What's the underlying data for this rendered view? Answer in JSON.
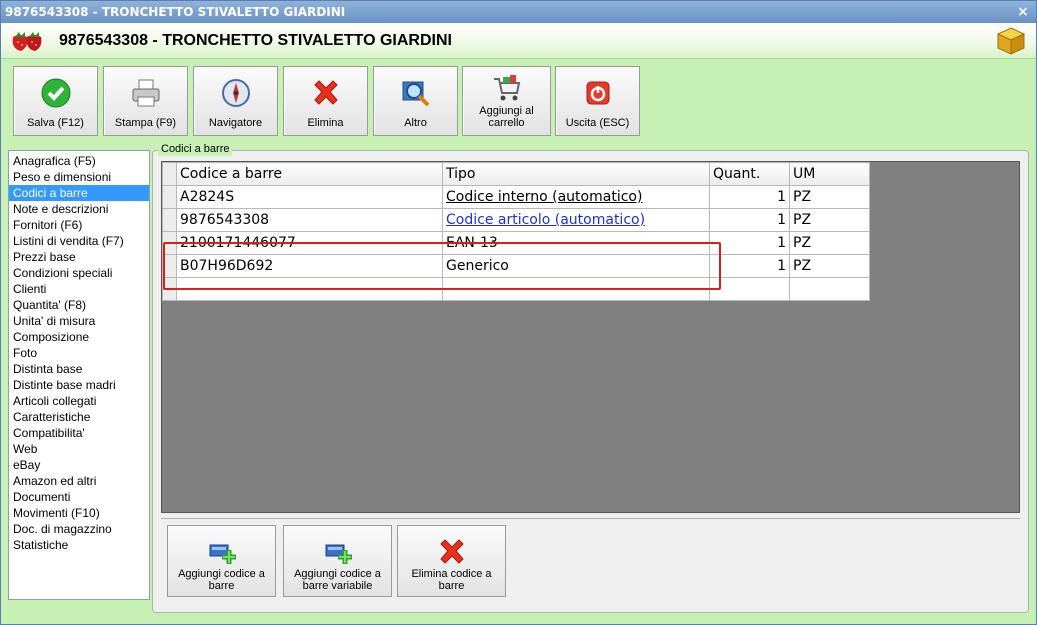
{
  "window": {
    "title": "9876543308 - TRONCHETTO STIVALETTO GIARDINI",
    "close": "×"
  },
  "header": {
    "title": "9876543308 - TRONCHETTO STIVALETTO GIARDINI",
    "logo_icon": "strawberry-icon",
    "corner_icon": "cube-icon"
  },
  "toolbar": [
    {
      "label": "Salva (F12)",
      "icon": "check-icon"
    },
    {
      "label": "Stampa (F9)",
      "icon": "printer-icon"
    },
    {
      "label": "Navigatore",
      "icon": "compass-icon"
    },
    {
      "label": "Elimina",
      "icon": "delete-x-icon"
    },
    {
      "label": "Altro",
      "icon": "magnifier-icon"
    },
    {
      "label": "Aggiungi al\ncarrello",
      "icon": "cart-icon"
    },
    {
      "label": "Uscita (ESC)",
      "icon": "power-icon"
    }
  ],
  "nav": [
    "Anagrafica (F5)",
    "Peso e dimensioni",
    "Codici a barre",
    "Note e descrizioni",
    "Fornitori (F6)",
    "Listini di vendita (F7)",
    "Prezzi base",
    "Condizioni speciali",
    "Clienti",
    "Quantita' (F8)",
    "Unita' di misura",
    "Composizione",
    "Foto",
    "Distinta base",
    "Distinte base madri",
    "Articoli collegati",
    "Caratteristiche",
    "Compatibilita'",
    "Web",
    "eBay",
    "Amazon ed altri",
    "Documenti",
    "Movimenti (F10)",
    "Doc. di magazzino",
    "Statistiche"
  ],
  "nav_selected": "Codici a barre",
  "group": {
    "label": "Codici a barre"
  },
  "grid": {
    "headers": [
      "Codice a barre",
      "Tipo",
      "Quant.",
      "UM"
    ],
    "rows": [
      {
        "code": "A2824S",
        "type": "Codice interno (automatico)",
        "qty": "1",
        "um": "PZ"
      },
      {
        "code": "9876543308",
        "type": "Codice articolo (automatico)",
        "qty": "1",
        "um": "PZ"
      },
      {
        "code": "2100171446077",
        "type": "EAN-13",
        "qty": "1",
        "um": "PZ"
      },
      {
        "code": "B07H96D692",
        "type": "Generico",
        "qty": "1",
        "um": "PZ"
      }
    ]
  },
  "bottom_buttons": [
    {
      "label": "Aggiungi codice a\nbarre",
      "icon": "add-barcode-icon"
    },
    {
      "label": "Aggiungi codice a\nbarre variabile",
      "icon": "add-variable-barcode-icon"
    },
    {
      "label": "Elimina codice a\nbarre",
      "icon": "delete-x-icon"
    }
  ],
  "colors": {
    "accent_selection": "#3399ff",
    "highlight_box": "#d81f1f",
    "window_bg": "#c6f0b4"
  }
}
